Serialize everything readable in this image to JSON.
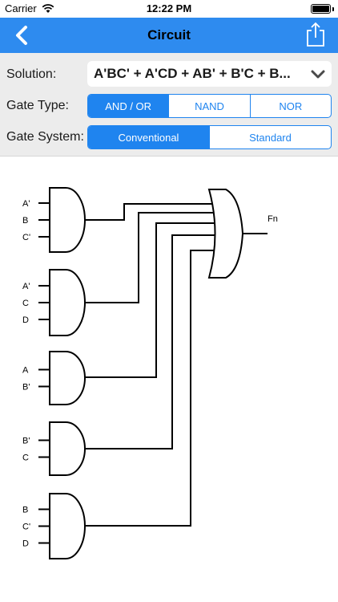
{
  "status_bar": {
    "carrier": "Carrier",
    "time": "12:22 PM"
  },
  "nav": {
    "title": "Circuit",
    "back_icon": "chevron-left-icon",
    "share_icon": "share-icon"
  },
  "settings": {
    "solution": {
      "label": "Solution:",
      "value": "A'BC' + A'CD + AB' + B'C + B..."
    },
    "gate_type": {
      "label": "Gate Type:",
      "options": [
        "AND / OR",
        "NAND",
        "NOR"
      ],
      "selected": 0
    },
    "gate_system": {
      "label": "Gate System:",
      "options": [
        "Conventional",
        "Standard"
      ],
      "selected": 0
    }
  },
  "circuit": {
    "output_label": "Fn",
    "gates": [
      {
        "inputs": [
          "A'",
          "B",
          "C'"
        ]
      },
      {
        "inputs": [
          "A'",
          "C",
          "D"
        ]
      },
      {
        "inputs": [
          "A",
          "B'"
        ]
      },
      {
        "inputs": [
          "B'",
          "C"
        ]
      },
      {
        "inputs": [
          "B",
          "C'",
          "D"
        ]
      }
    ]
  },
  "colors": {
    "nav_bar": "#2e8bef",
    "accent": "#1f84ef",
    "settings_bg": "#ececec"
  }
}
